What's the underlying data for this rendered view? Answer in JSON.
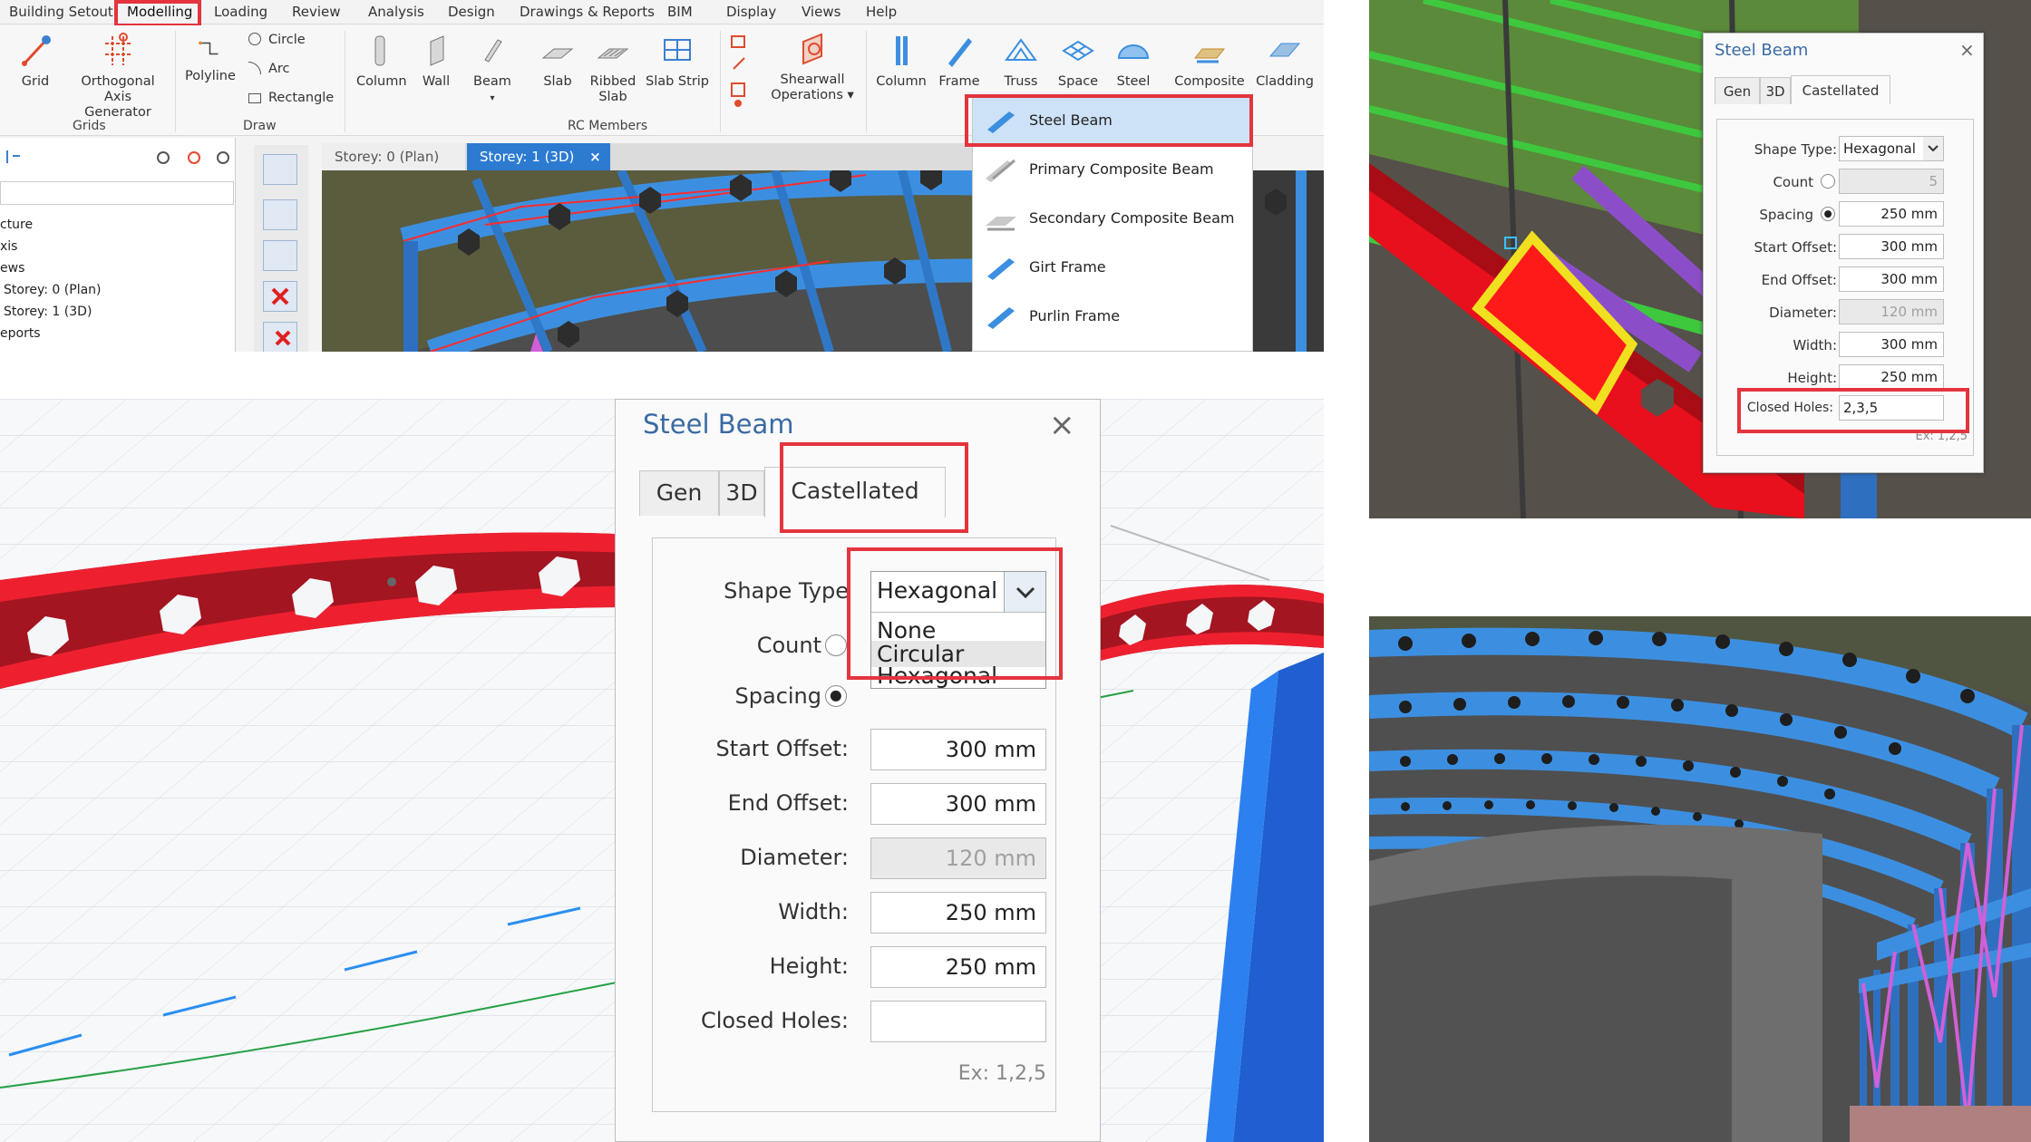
{
  "ribbon": {
    "menu": [
      "Building Setout",
      "Modelling",
      "Loading",
      "Review",
      "Analysis",
      "Design",
      "Drawings & Reports",
      "BIM",
      "Display",
      "Views",
      "Help"
    ],
    "buttons": {
      "grid": "Grid",
      "orth1": "Orthogonal",
      "orth2": "Axis Generator",
      "polyline": "Polyline",
      "circle": "Circle",
      "arc": "Arc",
      "rectangle": "Rectangle",
      "column": "Column",
      "wall": "Wall",
      "beam": "Beam",
      "slab": "Slab",
      "ribbed1": "Ribbed",
      "ribbed2": "Slab",
      "slabstrip": "Slab Strip",
      "shear1": "Shearwall",
      "shear2": "Operations ▾",
      "column2": "Column",
      "frame": "Frame",
      "truss": "Truss",
      "space": "Space",
      "steel": "Steel",
      "composite": "Composite",
      "cladding": "Cladding"
    },
    "groups": {
      "grids": "Grids",
      "draw": "Draw",
      "rc": "RC Members"
    },
    "tree": [
      "cture",
      "xis",
      "ews",
      "Storey: 0 (Plan)",
      "Storey: 1 (3D)",
      "eports"
    ],
    "tabs": [
      "Storey: 0 (Plan)",
      "Storey: 1 (3D)"
    ],
    "tab_close": "×",
    "dropdown": [
      "Steel Beam",
      "Primary Composite Beam",
      "Secondary Composite Beam",
      "Girt Frame",
      "Purlin Frame"
    ]
  },
  "dialog_large": {
    "title": "Steel Beam",
    "close": "×",
    "tabs": [
      "Gen",
      "3D",
      "Castellated"
    ],
    "labels": {
      "shape": "Shape Type",
      "count": "Count",
      "spacing": "Spacing",
      "start": "Start Offset:",
      "end": "End Offset:",
      "diameter": "Diameter:",
      "width": "Width:",
      "height": "Height:",
      "closed": "Closed Holes:"
    },
    "values": {
      "shape": "Hexagonal",
      "start": "300 mm",
      "end": "300 mm",
      "diameter": "120 mm",
      "width": "250 mm",
      "height": "250 mm",
      "closed": ""
    },
    "options": [
      "None",
      "Circular",
      "Hexagonal"
    ],
    "example": "Ex: 1,2,5"
  },
  "dialog_small": {
    "title": "Steel Beam",
    "close": "×",
    "tabs": [
      "Gen",
      "3D",
      "Castellated"
    ],
    "labels": {
      "shape": "Shape Type:",
      "count": "Count",
      "spacing": "Spacing",
      "start": "Start Offset:",
      "end": "End Offset:",
      "diameter": "Diameter:",
      "width": "Width:",
      "height": "Height:",
      "closed": "Closed Holes:"
    },
    "values": {
      "shape": "Hexagonal",
      "count": "5",
      "spacing": "250 mm",
      "start": "300 mm",
      "end": "300 mm",
      "diameter": "120 mm",
      "width": "300 mm",
      "height": "250 mm",
      "closed": "2,3,5"
    },
    "example": "Ex: 1,2,5"
  },
  "colors": {
    "highlight": "#e4343e",
    "steel_blue": "#3c8fe0",
    "beam_red": "#e8101c",
    "brace_pink": "#d060d8"
  }
}
